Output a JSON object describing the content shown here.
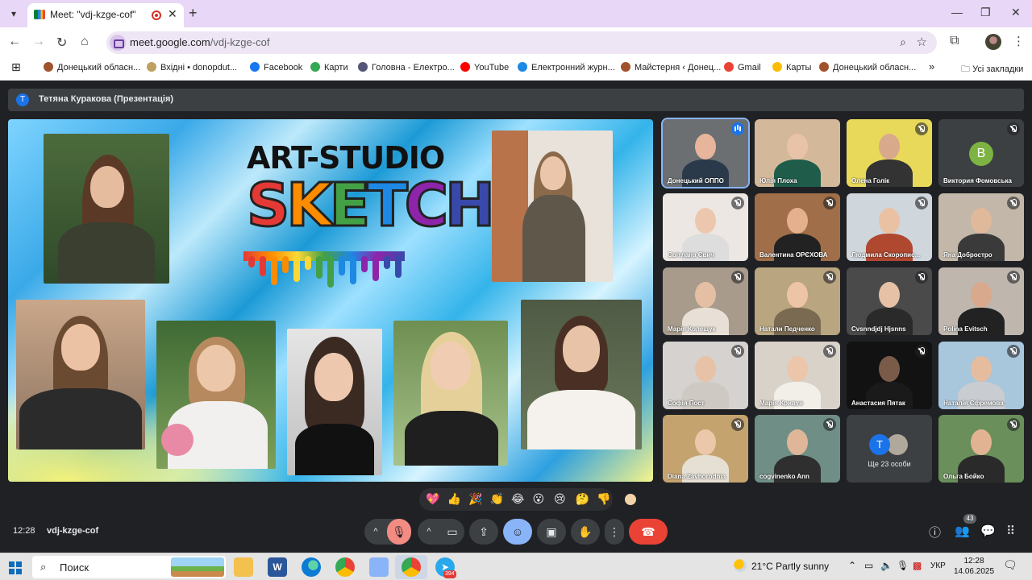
{
  "browser": {
    "tab_title": "Meet: \"vdj-kzge-cof\"",
    "url_host": "meet.google.com",
    "url_path": "/vdj-kzge-cof",
    "bookmarks": [
      {
        "label": "Донецький обласн...",
        "color": "#a0522d"
      },
      {
        "label": "Вхідні • donopdut...",
        "color": "#c0a060"
      },
      {
        "label": "Facebook",
        "color": "#1877f2"
      },
      {
        "label": "Карти",
        "color": "#34a853"
      },
      {
        "label": "Головна - Електро...",
        "color": "#555577"
      },
      {
        "label": "YouTube",
        "color": "#ff0000"
      },
      {
        "label": "Електронний журн...",
        "color": "#1e88e5"
      },
      {
        "label": "Майстерня ‹ Донец...",
        "color": "#a0522d"
      },
      {
        "label": "Gmail",
        "color": "#ea4335"
      },
      {
        "label": "Карты",
        "color": "#fbbc04"
      },
      {
        "label": "Донецький обласн...",
        "color": "#a0522d"
      }
    ],
    "all_bookmarks_label": "Усі закладки"
  },
  "meet": {
    "presenter_initial": "Т",
    "presenter_label": "Тетяна Куракова (Презентація)",
    "slide": {
      "logo_top": "ART-STUDIO",
      "logo_letters": [
        "S",
        "K",
        "E",
        "T",
        "C",
        "H"
      ],
      "logo_colors": [
        "#e53935",
        "#fb8c00",
        "#43a047",
        "#1e88e5",
        "#8e24aa",
        "#3949ab"
      ]
    },
    "participants": [
      {
        "name": "Донецький ОППО",
        "state": "speaking",
        "bg": "#6b6f72",
        "skin": "#e7b59b",
        "shirt": "#2b3a4a"
      },
      {
        "name": "Юлія Плоха",
        "state": "none",
        "bg": "#d4b89a",
        "skin": "#e9c3a7",
        "shirt": "#1f5c4a"
      },
      {
        "name": "Олена Голік",
        "state": "muted",
        "bg": "#e8d95a",
        "skin": "#d9a98c",
        "shirt": "#333333"
      },
      {
        "name": "Виктория Фомовська",
        "state": "muted",
        "avatar": "В",
        "bg": "#3c4043"
      },
      {
        "name": "Світлана Євич",
        "state": "muted",
        "bg": "#ece7e2",
        "skin": "#edc7ad",
        "shirt": "#dddddd"
      },
      {
        "name": "Валентина ОРЄХОВА",
        "state": "muted",
        "bg": "#a06e48",
        "skin": "#e4b08e",
        "shirt": "#222222"
      },
      {
        "name": "Людмила Скоропис...",
        "state": "muted",
        "bg": "#cfd6dc",
        "skin": "#eac1a3",
        "shirt": "#b0472f"
      },
      {
        "name": "Яна Добростро",
        "state": "muted",
        "bg": "#c2b7a8",
        "skin": "#e0b89a",
        "shirt": "#3a3a3a"
      },
      {
        "name": "Марія Колещук",
        "state": "muted",
        "bg": "#a89b8c",
        "skin": "#e5bfa3",
        "shirt": "#e8e0d6"
      },
      {
        "name": "Натали Педченко",
        "state": "muted",
        "bg": "#b9a57f",
        "skin": "#eec4a6",
        "shirt": "#7a6a52"
      },
      {
        "name": "Cvsnndjdj Hjsnns",
        "state": "muted",
        "bg": "#4a4a4a",
        "skin": "#e6c1a6",
        "shirt": "#2a2a2a"
      },
      {
        "name": "Polina Evitsch",
        "state": "muted",
        "bg": "#bfb6ae",
        "skin": "#d9a98d",
        "shirt": "#222222"
      },
      {
        "name": "Софія Пост",
        "state": "muted",
        "bg": "#d5d2d0",
        "skin": "#e8c2a6",
        "shirt": "#cfc9c3"
      },
      {
        "name": "Марія Кривун",
        "state": "muted",
        "bg": "#d8d2c9",
        "skin": "#ecc6aa",
        "shirt": "#f2eee8"
      },
      {
        "name": "Анастасия Пятак",
        "state": "muted",
        "bg": "#121212",
        "skin": "#7a5b4a",
        "shirt": "#1a1a1a"
      },
      {
        "name": "Наталія Єфремова",
        "state": "muted",
        "bg": "#a8c6dc",
        "skin": "#e5bc9e",
        "shirt": "#c9cdd1"
      },
      {
        "name": "Diana Zavhorodnia",
        "state": "muted",
        "bg": "#c4a36f",
        "skin": "#ecc8aa",
        "shirt": "#e6e0d4"
      },
      {
        "name": "cogvinenko Ann",
        "state": "muted",
        "bg": "#6f8e86",
        "skin": "#dfb698",
        "shirt": "#2f2f2f"
      }
    ],
    "more": {
      "initial": "Т",
      "label": "Ще 23 особи"
    },
    "last_participant": {
      "name": "Ольга Бойко",
      "state": "muted",
      "bg": "#6a8f5a",
      "skin": "#e2b393",
      "shirt": "#2a2a2a"
    },
    "reactions": [
      "💖",
      "👍",
      "🎉",
      "👏",
      "😂",
      "😮",
      "😢",
      "🤔",
      "👎"
    ],
    "time": "12:28",
    "meeting_code": "vdj-kzge-cof",
    "participants_count": "43"
  },
  "taskbar": {
    "search_placeholder": "Поиск",
    "weather": "21°C  Partly sunny",
    "lang": "УКР",
    "clock_time": "12:28",
    "clock_date": "14.06.2025",
    "telegram_badge": "394"
  }
}
